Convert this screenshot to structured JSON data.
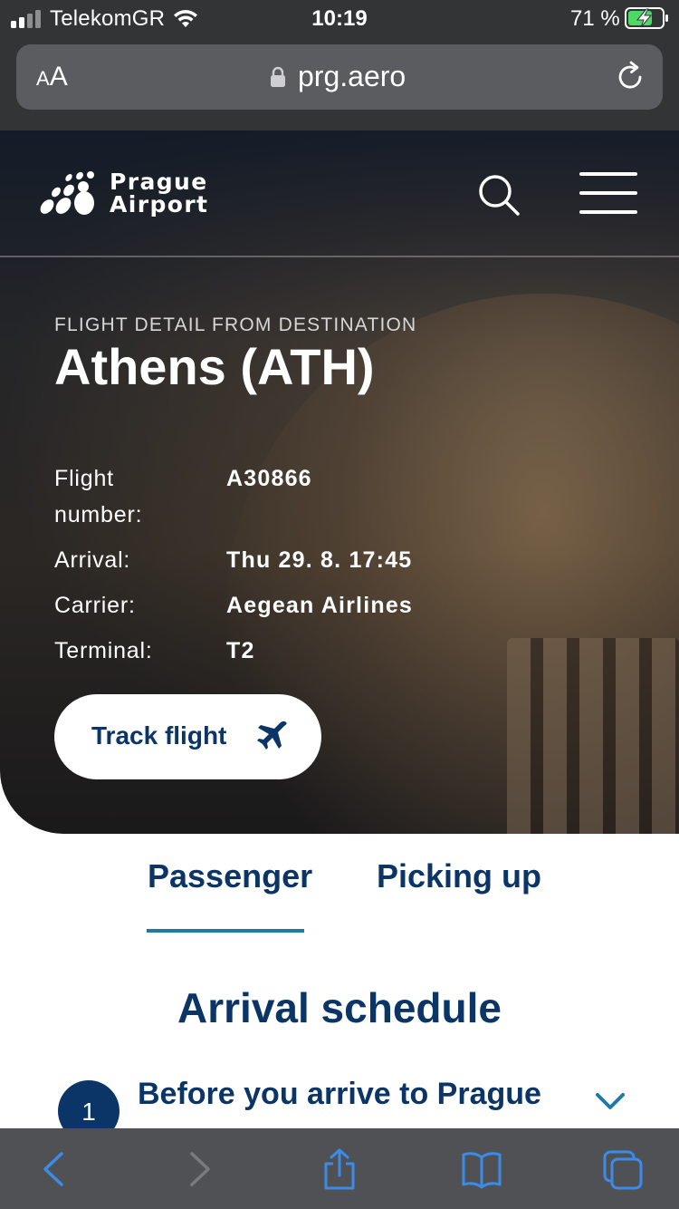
{
  "status_bar": {
    "carrier": "TelekomGR",
    "time": "10:19",
    "battery_pct": "71 %",
    "battery_level": 0.71
  },
  "url_bar": {
    "text_size_label": "A",
    "text_size_label_large": "A",
    "url": "prg.aero"
  },
  "header": {
    "logo_line1": "Prague",
    "logo_line2": "Airport"
  },
  "hero": {
    "eyebrow": "FLIGHT DETAIL FROM DESTINATION",
    "destination": "Athens (ATH)",
    "details": [
      {
        "label": "Flight number:",
        "value": "A30866"
      },
      {
        "label": "Arrival:",
        "value": "Thu 29. 8. 17:45"
      },
      {
        "label": "Carrier:",
        "value": "Aegean Airlines"
      },
      {
        "label": "Terminal:",
        "value": "T2"
      }
    ],
    "track_button": "Track flight"
  },
  "tabs": [
    {
      "label": "Passenger",
      "active": true
    },
    {
      "label": "Picking up",
      "active": false
    }
  ],
  "section": {
    "title": "Arrival schedule",
    "steps": [
      {
        "number": "1",
        "title": "Before you arrive to Prague"
      }
    ]
  },
  "colors": {
    "brand_navy": "#0b3566",
    "tab_accent": "#1f7aa6",
    "chrome_dark": "#333436",
    "toolbar_icon": "#3b8bea"
  },
  "toolbar_icons": [
    "back-icon",
    "forward-icon",
    "share-icon",
    "bookmarks-icon",
    "tabs-icon"
  ]
}
